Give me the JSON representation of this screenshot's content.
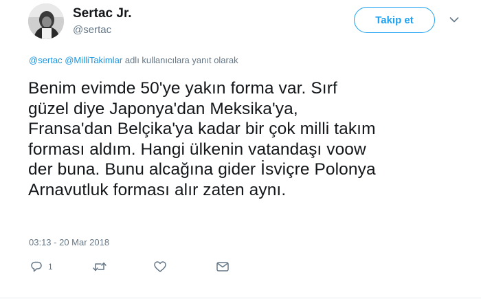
{
  "author": {
    "name": "Sertac Jr.",
    "handle": "@sertac",
    "avatar_icon": "profile-photo"
  },
  "follow_button": {
    "label": "Takip et",
    "color": "#1da1f2"
  },
  "more_menu": {
    "icon": "chevron-down-icon"
  },
  "reply_context": {
    "mention_1": "@sertac",
    "mention_2": "@MilliTakimlar",
    "suffix": "adlı kullanıcılara yanıt olarak",
    "mention_color": "#1b95e0"
  },
  "tweet": {
    "lines": [
      "Benim evimde 50'ye yakın forma var. Sırf",
      "güzel diye Japonya'dan Meksika'ya,",
      "Fransa'dan Belçika'ya kadar bir çok milli takım",
      "forması aldım. Hangi ülkenin vatandaşı voow",
      "der buna. Bunu alcağına gider İsviçre Polonya",
      "Arnavutluk forması alır zaten aynı."
    ],
    "timestamp": "03:13 - 20 Mar 2018"
  },
  "actions": {
    "reply_count": "1",
    "icons": [
      "reply-icon",
      "retweet-icon",
      "like-icon",
      "direct-message-icon"
    ]
  }
}
